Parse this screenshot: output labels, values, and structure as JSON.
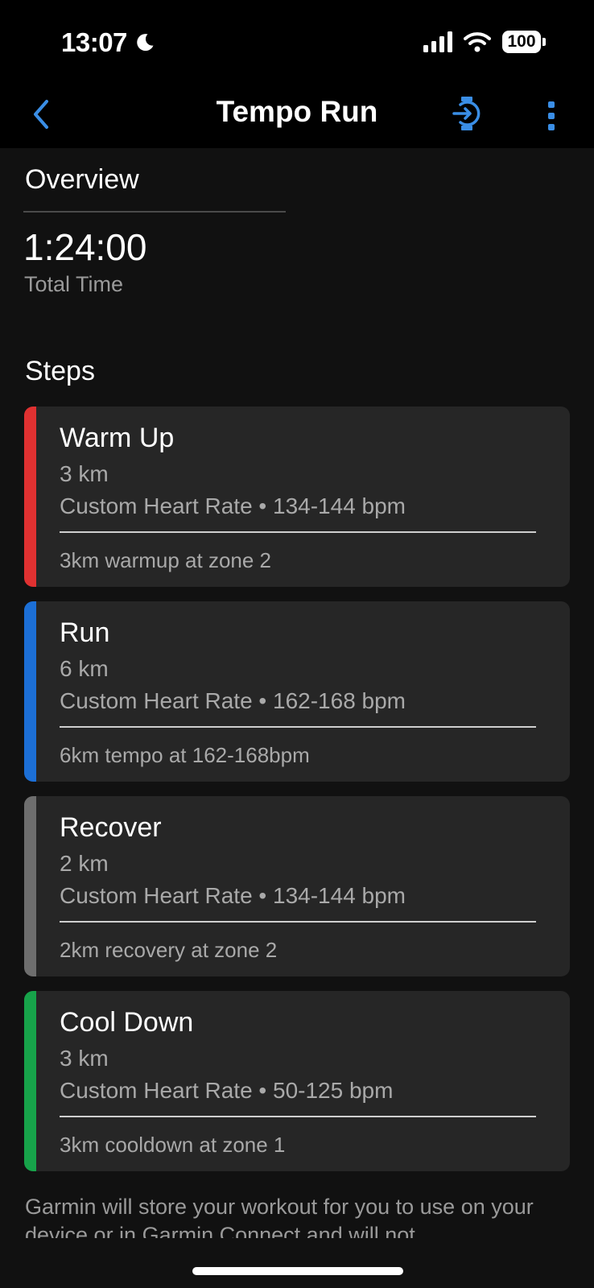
{
  "status_bar": {
    "time": "13:07",
    "battery": "100"
  },
  "nav": {
    "title": "Tempo Run"
  },
  "overview": {
    "heading": "Overview",
    "total_time": "1:24:00",
    "total_time_label": "Total Time"
  },
  "steps_heading": "Steps",
  "steps": [
    {
      "title": "Warm Up",
      "distance": "3 km",
      "target": "Custom Heart Rate • 134-144 bpm",
      "note": "3km warmup at zone 2",
      "color": "#e03131"
    },
    {
      "title": "Run",
      "distance": "6 km",
      "target": "Custom Heart Rate • 162-168 bpm",
      "note": "6km tempo at 162-168bpm",
      "color": "#1c6fd6"
    },
    {
      "title": "Recover",
      "distance": "2 km",
      "target": "Custom Heart Rate • 134-144 bpm",
      "note": "2km recovery at zone 2",
      "color": "#6e6e6e"
    },
    {
      "title": "Cool Down",
      "distance": "3 km",
      "target": "Custom Heart Rate • 50-125 bpm",
      "note": "3km cooldown at zone 1",
      "color": "#17a34a"
    }
  ],
  "footer": "Garmin will store your workout for you to use on your device or in Garmin Connect and will not",
  "colors": {
    "accent": "#3a8ee6",
    "background": "#111111",
    "card": "#262626"
  }
}
